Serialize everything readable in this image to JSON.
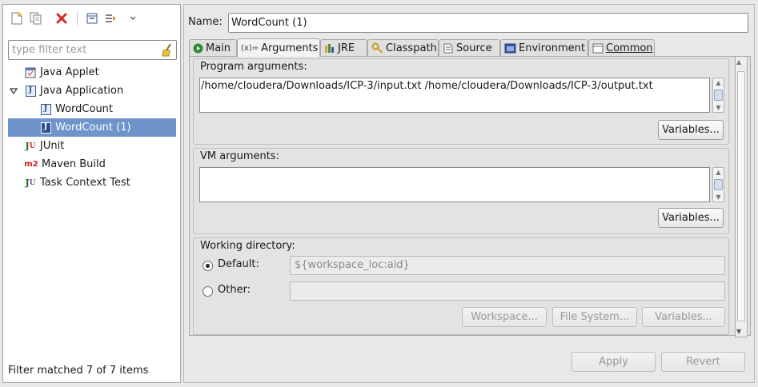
{
  "left": {
    "filter_placeholder": "type filter text",
    "tree": [
      {
        "label": "Java Applet",
        "icon": "applet-icon"
      },
      {
        "label": "Java Application",
        "icon": "java-app-icon",
        "expanded": true
      },
      {
        "label": "WordCount",
        "icon": "java-file-icon"
      },
      {
        "label": "WordCount (1)",
        "icon": "java-file-icon",
        "selected": true
      },
      {
        "label": "JUnit",
        "icon": "junit-icon"
      },
      {
        "label": "Maven Build",
        "icon": "maven-icon"
      },
      {
        "label": "Task Context Test",
        "icon": "task-context-icon"
      }
    ],
    "status": "Filter matched 7 of 7 items"
  },
  "right": {
    "name_label": "Name:",
    "name_value": "WordCount (1)",
    "tabs": [
      {
        "label": "Main",
        "icon": "main-tab-icon"
      },
      {
        "label": "Arguments",
        "icon": "arguments-tab-icon",
        "active": true
      },
      {
        "label": "JRE",
        "icon": "jre-tab-icon"
      },
      {
        "label": "Classpath",
        "icon": "classpath-tab-icon"
      },
      {
        "label": "Source",
        "icon": "source-tab-icon"
      },
      {
        "label": "Environment",
        "icon": "environment-tab-icon"
      },
      {
        "label": "Common",
        "icon": "common-tab-icon"
      }
    ],
    "program_args": {
      "title": "Program arguments:",
      "value": "/home/cloudera/Downloads/ICP-3/input.txt /home/cloudera/Downloads/ICP-3/output.txt",
      "variables_button": "Variables..."
    },
    "vm_args": {
      "title": "VM arguments:",
      "value": "",
      "variables_button": "Variables..."
    },
    "working_dir": {
      "title": "Working directory:",
      "default_label": "Default:",
      "default_value": "${workspace_loc:aid}",
      "other_label": "Other:",
      "other_value": "",
      "workspace_button": "Workspace...",
      "filesystem_button": "File System...",
      "variables_button": "Variables..."
    },
    "apply_button": "Apply",
    "revert_button": "Revert"
  }
}
